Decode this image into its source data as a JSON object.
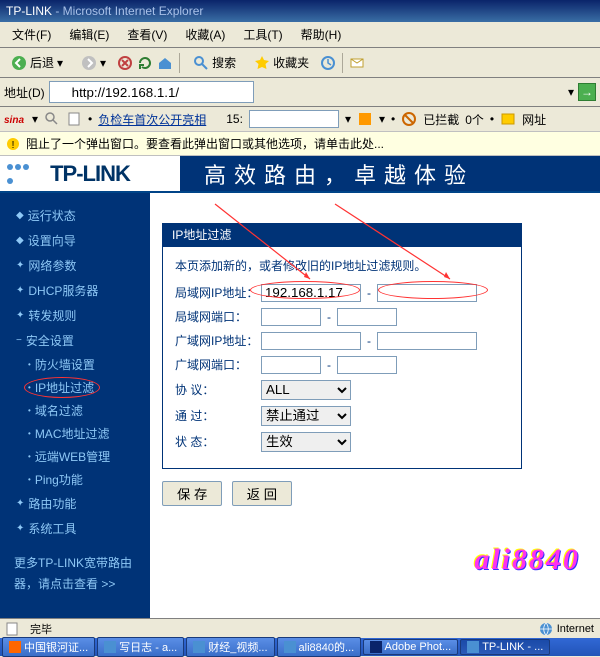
{
  "window": {
    "title_app": "TP-LINK",
    "title_suffix": " - Microsoft Internet Explorer"
  },
  "menubar": {
    "file": "文件(F)",
    "edit": "编辑(E)",
    "view": "查看(V)",
    "fav": "收藏(A)",
    "tools": "工具(T)",
    "help": "帮助(H)"
  },
  "toolbar": {
    "back": "后退",
    "search": "搜索",
    "favorites": "收藏夹"
  },
  "address": {
    "label": "地址(D)",
    "url": "http://192.168.1.1/"
  },
  "sinabar": {
    "link_text": "负检车首次公开亮相",
    "count_label": "15:",
    "blocked_label": "已拦截",
    "blocked_count": "0个",
    "urls_label": "网址"
  },
  "infobar": {
    "text": "阻止了一个弹出窗口。要查看此弹出窗口或其他选项，请单击此处..."
  },
  "banner": {
    "logo": "TP-LINK",
    "slogan": "高效路由，卓越体验"
  },
  "sidebar": {
    "items": [
      "运行状态",
      "设置向导",
      "网络参数",
      "DHCP服务器",
      "转发规则",
      "安全设置"
    ],
    "subitems": [
      "防火墙设置",
      "IP地址过滤",
      "域名过滤",
      "MAC地址过滤",
      "远端WEB管理",
      "Ping功能"
    ],
    "items2": [
      "路由功能",
      "系统工具"
    ],
    "more_line1": "更多TP-LINK宽带路由",
    "more_line2": "器，请点击查看 >>"
  },
  "panel": {
    "title": "IP地址过滤",
    "desc": "本页添加新的，或者修改旧的IP地址过滤规则。",
    "rows": {
      "lan_ip": {
        "label": "局域网IP地址：",
        "value1": "192.168.1.17",
        "value2": ""
      },
      "lan_port": {
        "label": "局域网端口：",
        "value1": "",
        "value2": ""
      },
      "wan_ip": {
        "label": "广域网IP地址：",
        "value1": "",
        "value2": ""
      },
      "wan_port": {
        "label": "广域网端口：",
        "value1": "",
        "value2": ""
      },
      "protocol": {
        "label": "协 议：",
        "value": "ALL"
      },
      "pass": {
        "label": "通 过：",
        "value": "禁止通过"
      },
      "status": {
        "label": "状 态：",
        "value": "生效"
      }
    },
    "buttons": {
      "save": "保 存",
      "back": "返 回"
    }
  },
  "watermark": "ali8840",
  "statusbar": {
    "done": "完毕",
    "zone": "Internet"
  },
  "taskbar": {
    "items": [
      "中国银河证...",
      "写日志 - a...",
      "财经_视频...",
      "ali8840的...",
      "Adobe Phot...",
      "TP-LINK - ..."
    ]
  },
  "colors": {
    "tp_blue": "#003377",
    "ie_bg": "#ece9d8",
    "link": "#003399",
    "anno": "#ff3333"
  }
}
